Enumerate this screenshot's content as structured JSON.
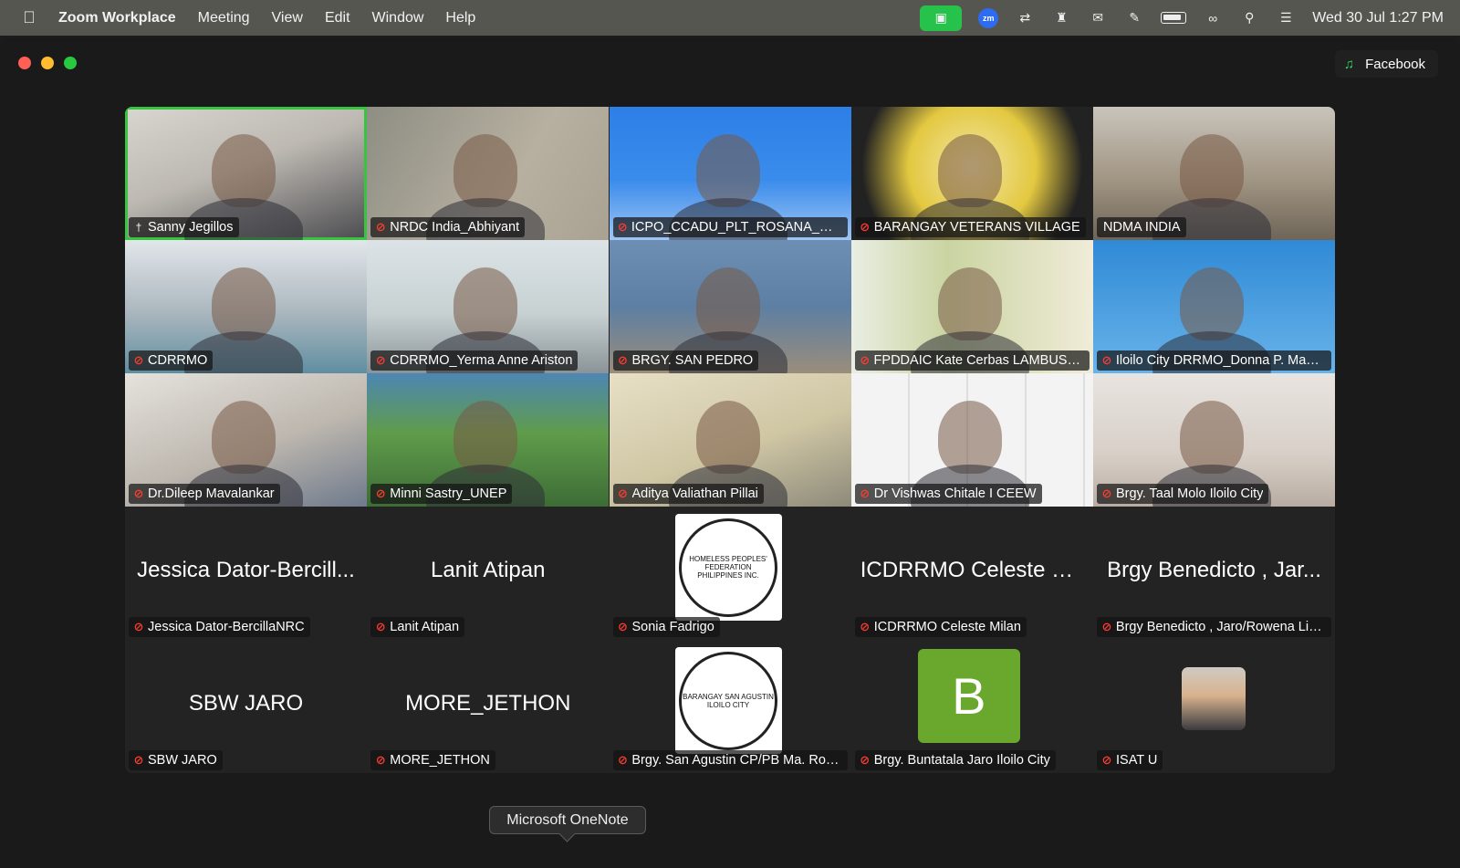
{
  "menubar": {
    "app_name": "Zoom Workplace",
    "menus": [
      "Meeting",
      "View",
      "Edit",
      "Window",
      "Help"
    ],
    "clock": "Wed 30 Jul  1:27 PM",
    "status_icons": [
      "zoom-camera-icon",
      "zoom-app-icon",
      "teamviewer-icon",
      "teams-icon",
      "outlook-icon",
      "onenote-icon",
      "battery-icon",
      "link-icon",
      "search-icon",
      "control-center-icon"
    ]
  },
  "window": {
    "live_stream_label": "Facebook"
  },
  "participants": [
    {
      "name": "Sanny Jegillos",
      "active": true,
      "pinned": true,
      "type": "video",
      "bg": "bg1"
    },
    {
      "name": "NRDC India_Abhiyant",
      "type": "video",
      "bg": "bg2"
    },
    {
      "name": "ICPO_CCADU_PLT_ROSANA_MO...",
      "type": "video",
      "bg": "bg3"
    },
    {
      "name": "BARANGAY VETERANS VILLAGE",
      "type": "video",
      "bg": "bg4"
    },
    {
      "name": "NDMA INDIA",
      "type": "video",
      "bg": "bg5",
      "unmuted": true
    },
    {
      "name": "CDRRMO",
      "type": "video",
      "bg": "bg6"
    },
    {
      "name": "CDRRMO_Yerma Anne Ariston",
      "type": "video",
      "bg": "bg7"
    },
    {
      "name": "BRGY. SAN PEDRO",
      "type": "video",
      "bg": "bg8"
    },
    {
      "name": "FPDDAIC Kate Cerbas LAMBUSON",
      "type": "video",
      "bg": "bg9"
    },
    {
      "name": "Iloilo City DRRMO_Donna P. Magno",
      "type": "video",
      "bg": "bg10"
    },
    {
      "name": "Dr.Dileep Mavalankar",
      "type": "video",
      "bg": "bg11"
    },
    {
      "name": "Minni Sastry_UNEP",
      "type": "video",
      "bg": "bg12"
    },
    {
      "name": "Aditya Valiathan Pillai",
      "type": "video",
      "bg": "bg13"
    },
    {
      "name": "Dr Vishwas Chitale I CEEW",
      "type": "video",
      "bg": "bg14"
    },
    {
      "name": "Brgy. Taal Molo Iloilo City",
      "type": "video",
      "bg": "bg15"
    },
    {
      "name": "Jessica Dator-BercillaNRC",
      "display": "Jessica Dator-Bercill...",
      "type": "name"
    },
    {
      "name": "Lanit Atipan",
      "display": "Lanit Atipan",
      "type": "name"
    },
    {
      "name": "Sonia Fadrigo",
      "type": "logo",
      "logo_text": "HOMELESS PEOPLES' FEDERATION PHILIPPINES INC."
    },
    {
      "name": "ICDRRMO Celeste Milan",
      "display": "ICDRRMO Celeste M...",
      "type": "name"
    },
    {
      "name": "Brgy Benedicto , Jaro/Rowena Lib...",
      "display": "Brgy Benedicto , Jar...",
      "type": "name"
    },
    {
      "name": "SBW JARO",
      "display": "SBW JARO",
      "type": "name"
    },
    {
      "name": "MORE_JETHON",
      "display": "MORE_JETHON",
      "type": "name"
    },
    {
      "name": "Brgy. San Agustin CP/PB Ma. Ros...",
      "type": "logo",
      "logo_text": "BARANGAY SAN AGUSTIN ILOILO CITY"
    },
    {
      "name": "Brgy. Buntatala Jaro Iloilo City",
      "type": "letter",
      "letter": "B"
    },
    {
      "name": "ISAT U",
      "type": "photo"
    }
  ],
  "tooltip": "Microsoft OneNote"
}
